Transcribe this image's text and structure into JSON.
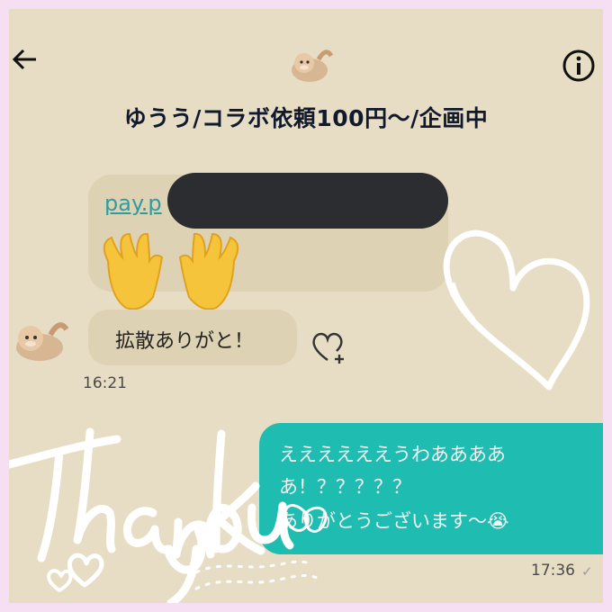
{
  "header": {
    "title": "ゆうう/コラボ依頼100円〜/企画中",
    "back_icon": "arrow-left-icon",
    "info_icon": "info-circle-icon"
  },
  "messages": {
    "incoming": {
      "link_text": "pay.p",
      "hands_emoji": "raised-hands",
      "text": "拡散ありがと！",
      "time": "16:21"
    },
    "outgoing": {
      "line1": "ええええええうわああああ",
      "line2": "あ！？？？？？",
      "line3": "ありがとうございます〜😭",
      "time": "17:36"
    }
  },
  "decorations": {
    "heart_doodle": "heart-outline",
    "handwriting": "Thank you"
  },
  "colors": {
    "background": "#e7dcc4",
    "outgoing_bubble": "#1fbcb2",
    "incoming_bubble": "#ddd2b4",
    "frame": "#f7dff3"
  }
}
